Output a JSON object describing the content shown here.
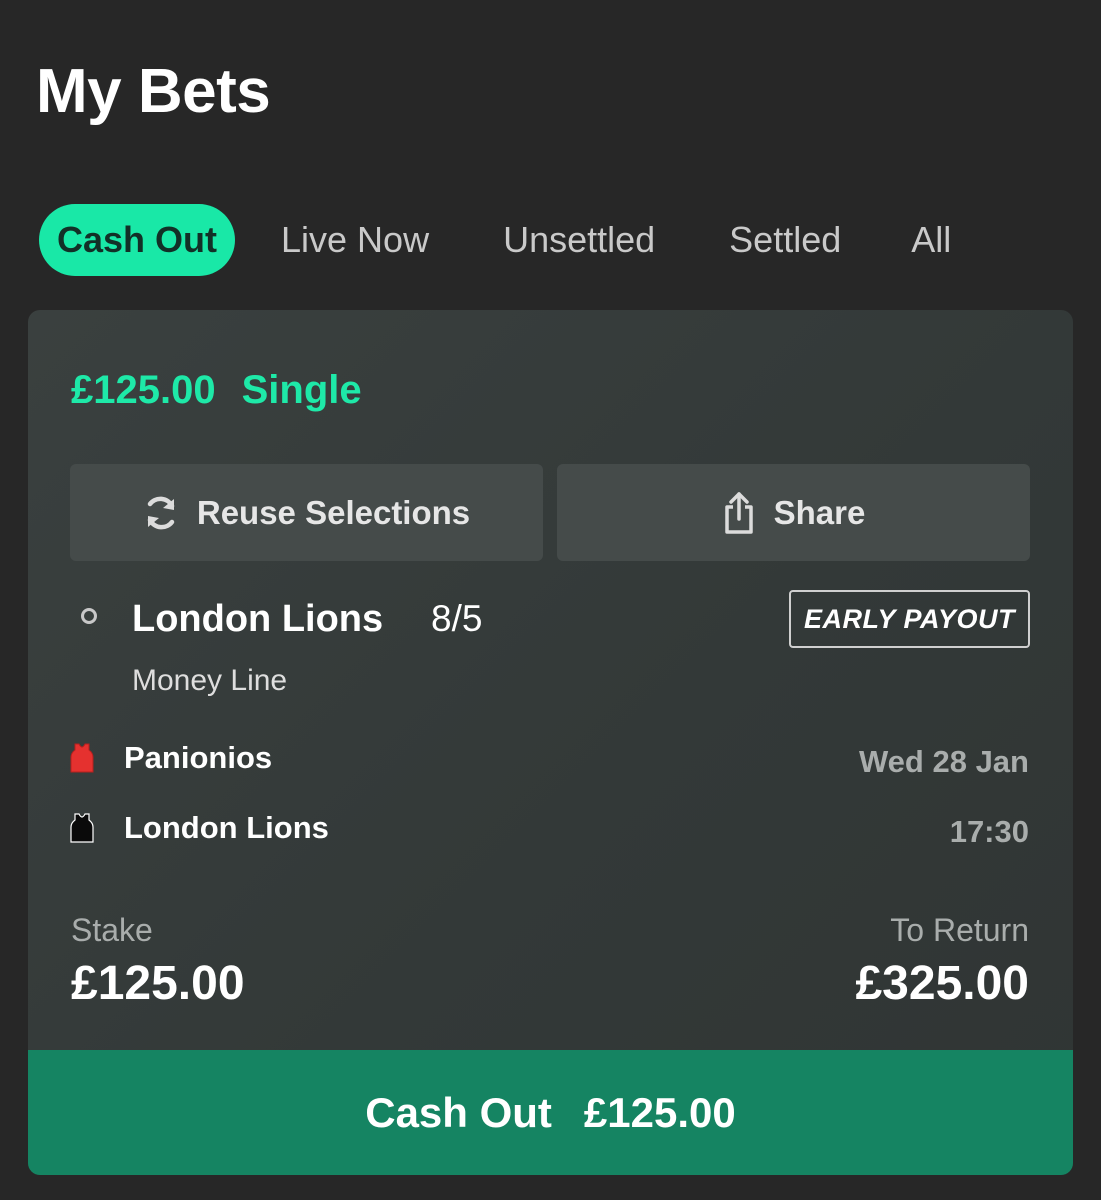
{
  "page": {
    "title": "My Bets"
  },
  "tabs": [
    {
      "label": "Cash Out",
      "active": true
    },
    {
      "label": "Live Now",
      "active": false
    },
    {
      "label": "Unsettled",
      "active": false
    },
    {
      "label": "Settled",
      "active": false
    },
    {
      "label": "All",
      "active": false
    }
  ],
  "bet": {
    "amount": "£125.00",
    "type": "Single",
    "reuse_label": "Reuse Selections",
    "share_label": "Share",
    "selection": "London Lions",
    "odds": "8/5",
    "badge": "EARLY PAYOUT",
    "market": "Money Line",
    "home_team": "Panionios",
    "away_team": "London Lions",
    "home_jersey_color": "#e5312f",
    "away_jersey_color": "#0a0a0a",
    "date": "Wed 28 Jan",
    "time": "17:30",
    "stake_label": "Stake",
    "stake_value": "£125.00",
    "return_label": "To Return",
    "return_value": "£325.00",
    "cashout_label": "Cash Out",
    "cashout_value": "£125.00"
  },
  "colors": {
    "accent": "#19e8a7",
    "cashout_button": "#158462",
    "background": "#272727"
  },
  "icons": {
    "reuse": "refresh-icon",
    "share": "share-icon"
  }
}
